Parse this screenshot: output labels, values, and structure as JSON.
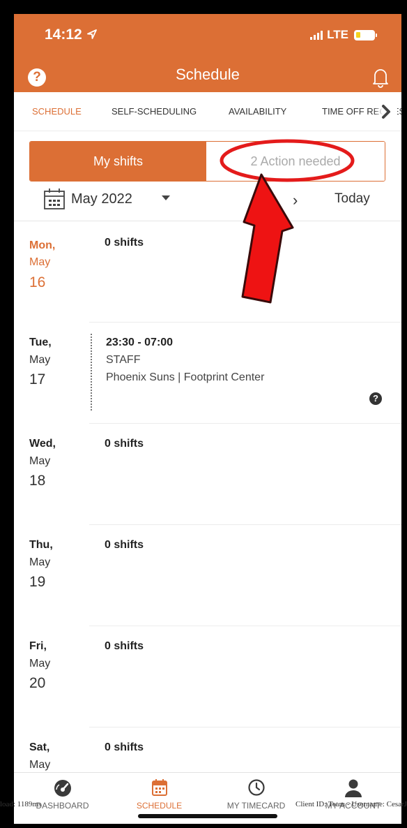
{
  "status": {
    "time": "14:12",
    "network": "LTE"
  },
  "header": {
    "title": "Schedule",
    "help_icon_glyph": "?"
  },
  "tabs": [
    {
      "label": "SCHEDULE",
      "active": true
    },
    {
      "label": "SELF-SCHEDULING"
    },
    {
      "label": "AVAILABILITY"
    },
    {
      "label": "TIME OFF REQUESTS"
    }
  ],
  "segment": {
    "left": "My shifts",
    "right": "2 Action needed"
  },
  "calendar": {
    "month": "May 2022",
    "prev": "‹",
    "next": "›",
    "today": "Today"
  },
  "days": [
    {
      "weekday": "Mon,",
      "month": "May",
      "day": "16",
      "summary": "0 shifts",
      "is_today": true
    },
    {
      "weekday": "Tue,",
      "month": "May",
      "day": "17",
      "shift": {
        "time": "23:30 - 07:00",
        "role": "STAFF",
        "location": "Phoenix Suns | Footprint Center",
        "help": "?"
      }
    },
    {
      "weekday": "Wed,",
      "month": "May",
      "day": "18",
      "summary": "0 shifts"
    },
    {
      "weekday": "Thu,",
      "month": "May",
      "day": "19",
      "summary": "0 shifts"
    },
    {
      "weekday": "Fri,",
      "month": "May",
      "day": "20",
      "summary": "0 shifts"
    },
    {
      "weekday": "Sat,",
      "month": "May",
      "summary": "0 shifts"
    }
  ],
  "nav": [
    {
      "label": "DASHBOARD",
      "icon": "dashboard-icon"
    },
    {
      "label": "SCHEDULE",
      "icon": "calendar-icon",
      "active": true
    },
    {
      "label": "MY TIMECARD",
      "icon": "clock-icon"
    },
    {
      "label": "MY ACCOUNT",
      "icon": "user-icon"
    }
  ],
  "footer": {
    "left": "load: 1189ms",
    "right": "Client ID: Team - Username: CesarJ"
  },
  "colors": {
    "accent": "#dc6f35",
    "annotation": "#e41b1b"
  }
}
